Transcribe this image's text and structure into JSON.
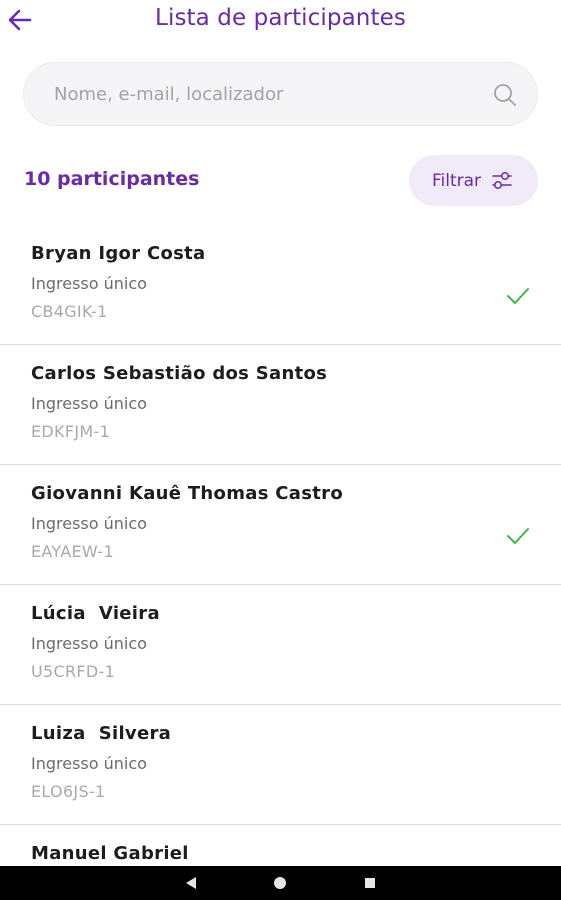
{
  "header": {
    "title": "Lista de participantes",
    "back_icon": "arrow-left-icon"
  },
  "search": {
    "placeholder": "Nome, e-mail, localizador",
    "value": ""
  },
  "summary": {
    "count_label": "10 participantes",
    "filter_label": "Filtrar"
  },
  "colors": {
    "accent": "#6a2aa8",
    "check": "#4caf50",
    "filter_bg": "#f1eaf8"
  },
  "participants": [
    {
      "name": "Bryan Igor Costa",
      "ticket": "Ingresso único",
      "code": "CB4GIK-1",
      "checked_in": true
    },
    {
      "name": "Carlos Sebastião dos Santos",
      "ticket": "Ingresso único",
      "code": "EDKFJM-1",
      "checked_in": false
    },
    {
      "name": "Giovanni Kauê Thomas Castro",
      "ticket": "Ingresso único",
      "code": "EAYAEW-1",
      "checked_in": true
    },
    {
      "name": "Lúcia  Vieira",
      "ticket": "Ingresso único",
      "code": "U5CRFD-1",
      "checked_in": false
    },
    {
      "name": "Luiza  Silvera",
      "ticket": "Ingresso único",
      "code": "ELO6JS-1",
      "checked_in": false
    },
    {
      "name": "Manuel Gabriel",
      "ticket": "",
      "code": "",
      "checked_in": false
    }
  ]
}
